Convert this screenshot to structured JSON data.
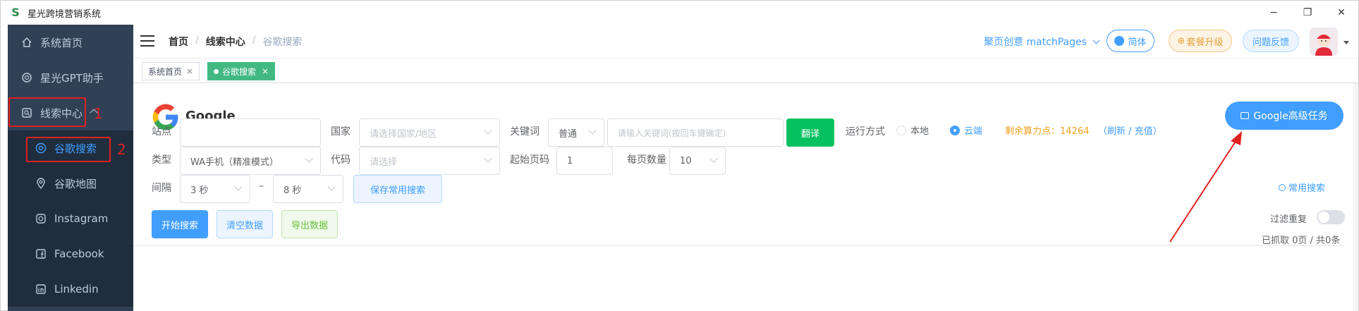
{
  "window": {
    "title": "星光跨境营销系统",
    "logo_letter": "S",
    "controls": [
      "−",
      "❐",
      "✕"
    ]
  },
  "sidebar": {
    "items": [
      {
        "label": "系统首页",
        "icon": "home-icon"
      },
      {
        "label": "星光GPT助手",
        "icon": "gpt-icon"
      },
      {
        "label": "线索中心",
        "icon": "lead-center-icon",
        "expanded": true
      },
      {
        "label": "谷歌搜索",
        "icon": "chrome-icon",
        "active": true
      },
      {
        "label": "谷歌地图",
        "icon": "map-pin-icon"
      },
      {
        "label": "Instagram",
        "icon": "instagram-icon"
      },
      {
        "label": "Facebook",
        "icon": "facebook-icon"
      },
      {
        "label": "Linkedin",
        "icon": "linkedin-icon"
      }
    ],
    "annotation_1": "1",
    "annotation_2": "2"
  },
  "navbar": {
    "breadcrumb": [
      "首页",
      "线索中心",
      "谷歌搜索"
    ],
    "match_pages": "聚页创意 matchPages",
    "lang": "简体",
    "upgrade": "套餐升级",
    "feedback": "问题反馈"
  },
  "tags": [
    {
      "label": "系统首页",
      "close": "×",
      "active": false
    },
    {
      "label": "谷歌搜索",
      "close": "×",
      "active": true
    }
  ],
  "main": {
    "title": "Google",
    "advanced_task_button": "Google高级任务",
    "form": {
      "site_label": "站点",
      "site_value": "",
      "country_label": "国家",
      "country_placeholder": "请选择国家/地区",
      "keyword_label": "关键词",
      "keyword_mode": "普通",
      "keyword_placeholder": "请输入关键词(按回车键确定)",
      "translate_button": "翻译",
      "run_mode_label": "运行方式",
      "run_mode_options": [
        "本地",
        "云端"
      ],
      "run_mode_selected": "云端",
      "credits_text": "剩余算力点：14264",
      "refresh_link": "刷新",
      "recharge_link": "充值",
      "type_label": "类型",
      "type_value": "WA手机（精准模式）",
      "code_label": "代码",
      "code_placeholder": "请选择",
      "start_page_label": "起始页码",
      "start_page_value": "1",
      "per_page_label": "每页数量",
      "per_page_value": "10",
      "interval_label": "间隔",
      "interval_from": "3 秒",
      "interval_to": "8 秒",
      "interval_dash": "–",
      "save_search_button": "保存常用搜索",
      "common_search_link": "常用搜索"
    },
    "actions": {
      "start": "开始搜索",
      "clear": "清空数据",
      "export": "导出数据"
    },
    "filter_dup_label": "过滤重复",
    "filter_dup_on": false,
    "summary": "已抓取 0页 / 共0条"
  },
  "colors": {
    "sidebar_bg": "#304156",
    "primary": "#409eff",
    "success": "#07c160",
    "warning": "#f0a020",
    "annotation_red": "#e02020"
  }
}
